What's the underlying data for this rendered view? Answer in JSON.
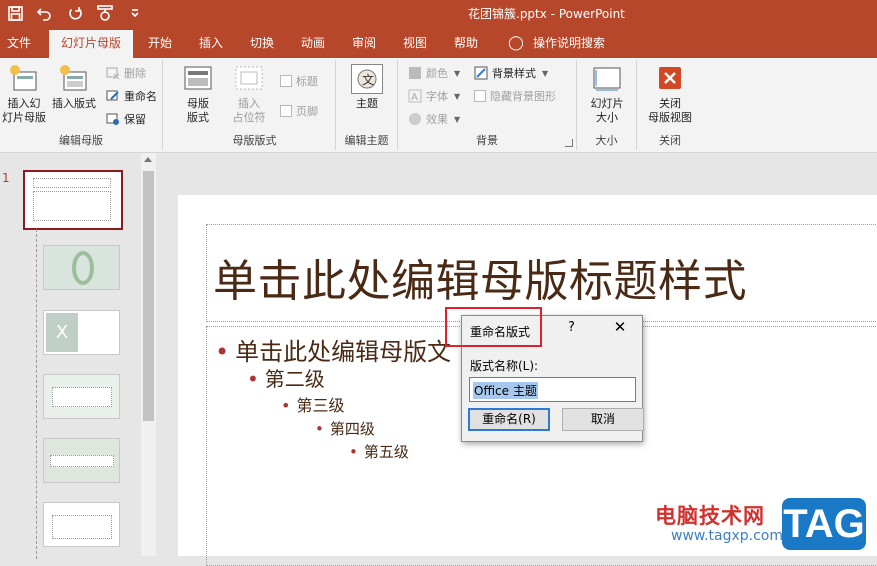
{
  "window": {
    "title": "花团锦簇.pptx  -  PowerPoint"
  },
  "qat": {
    "icons": [
      "save-icon",
      "undo-icon",
      "redo-icon",
      "present-icon",
      "customize-icon"
    ]
  },
  "tabs": [
    "文件",
    "幻灯片母版",
    "开始",
    "插入",
    "切换",
    "动画",
    "审阅",
    "视图",
    "帮助",
    "操作说明搜索"
  ],
  "active_tab": "幻灯片母版",
  "ribbon": {
    "edit_master": {
      "label": "编辑母版",
      "insert_master": "插入幻\n灯片母版",
      "insert_layout": "插入版式",
      "delete": "删除",
      "rename": "重命名",
      "preserve": "保留"
    },
    "master_layout": {
      "label": "母版版式",
      "master_layout_btn": "母版\n版式",
      "insert_placeholder": "插入\n占位符",
      "title_chk": "标题",
      "footer_chk": "页脚"
    },
    "edit_theme": {
      "label": "编辑主题",
      "themes": "主题"
    },
    "background": {
      "label": "背景",
      "colors": "颜色",
      "fonts": "字体",
      "effects": "效果",
      "bg_styles": "背景样式",
      "hide_bg": "隐藏背景图形"
    },
    "size": {
      "label": "大小",
      "slide_size": "幻灯片\n大小"
    },
    "close": {
      "label": "关闭",
      "close_master": "关闭\n母版视图"
    }
  },
  "thumbs": {
    "selected_number": "1"
  },
  "slide": {
    "title": "单击此处编辑母版标题样式",
    "levels": [
      "单击此处编辑母版文",
      "第二级",
      "第三级",
      "第四级",
      "第五级"
    ]
  },
  "dialog": {
    "title": "重命名版式",
    "help": "?",
    "close": "✕",
    "field_label": "版式名称(L):",
    "field_value": "Office 主题",
    "rename_btn": "重命名(R)",
    "cancel_btn": "取消"
  },
  "watermark": {
    "text": "电脑技术网",
    "url": "www.tagxp.com",
    "badge": "TAG"
  },
  "colors": {
    "accent": "#b7472a",
    "highlight": "#e0212b"
  }
}
